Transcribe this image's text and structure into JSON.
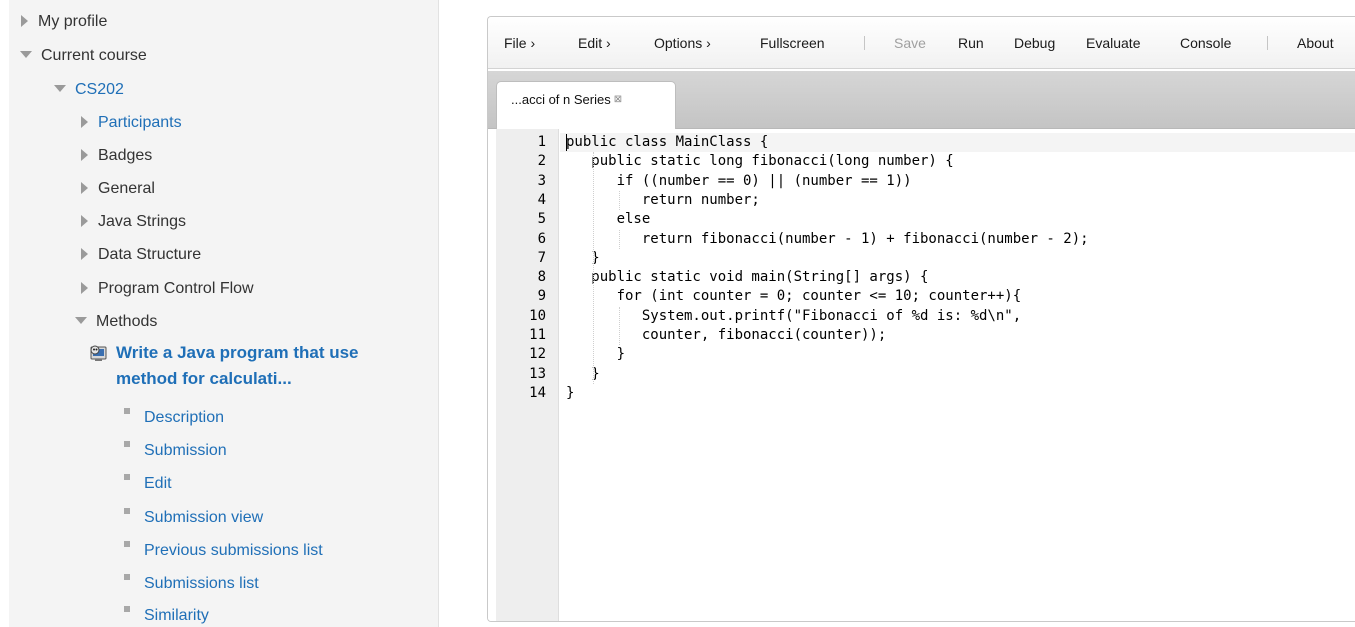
{
  "nav": {
    "my_profile": "My profile",
    "current_course": "Current course",
    "course_code": "CS202",
    "sections": [
      "Participants",
      "Badges",
      "General",
      "Java Strings",
      "Data Structure",
      "Program Control Flow",
      "Methods"
    ],
    "activity_title": "Write a Java program that use method for calculati...",
    "activity_items": [
      "Description",
      "Submission",
      "Edit",
      "Submission view",
      "Previous submissions list",
      "Submissions list",
      "Similarity"
    ]
  },
  "menubar": {
    "file": "File ›",
    "edit": "Edit ›",
    "options": "Options ›",
    "fullscreen": "Fullscreen",
    "save": "Save",
    "run": "Run",
    "debug": "Debug",
    "evaluate": "Evaluate",
    "console": "Console",
    "about": "About"
  },
  "tab": {
    "title": "...acci of n Series",
    "close_glyph": "⊠"
  },
  "editor": {
    "line_numbers": [
      "1",
      "2",
      "3",
      "4",
      "5",
      "6",
      "7",
      "8",
      "9",
      "10",
      "11",
      "12",
      "13",
      "14"
    ],
    "lines": [
      "public class MainClass {",
      "   public static long fibonacci(long number) {",
      "      if ((number == 0) || (number == 1))",
      "         return number;",
      "      else",
      "         return fibonacci(number - 1) + fibonacci(number - 2);",
      "   }",
      "   public static void main(String[] args) {",
      "      for (int counter = 0; counter <= 10; counter++){",
      "         System.out.printf(\"Fibonacci of %d is: %d\\n\",",
      "         counter, fibonacci(counter));",
      "      }",
      "   }",
      "}"
    ]
  },
  "colors": {
    "link": "#1f6fb7",
    "text": "#333333",
    "disabled": "#a0a0a0"
  }
}
